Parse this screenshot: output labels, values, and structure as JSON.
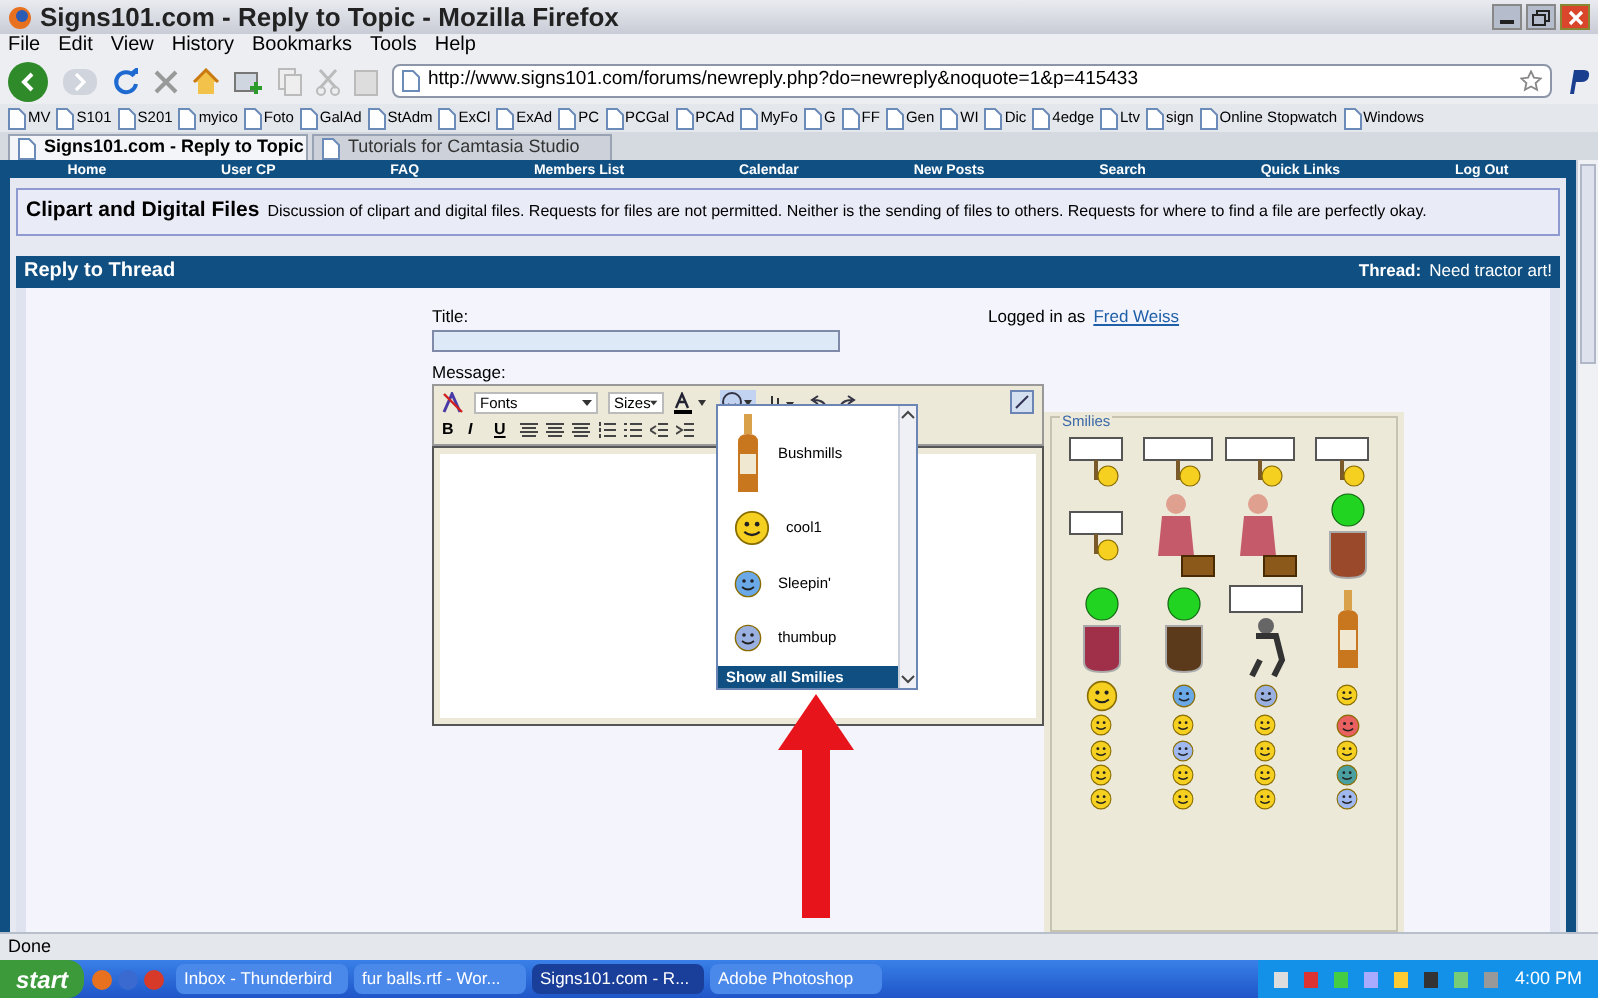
{
  "window": {
    "title": "Signs101.com - Reply to Topic - Mozilla Firefox"
  },
  "menu": [
    "File",
    "Edit",
    "View",
    "History",
    "Bookmarks",
    "Tools",
    "Help"
  ],
  "address": {
    "value": "http://www.signs101.com/forums/newreply.php?do=newreply&noquote=1&p=415433"
  },
  "bookmarks": [
    "MV",
    "S101",
    "S201",
    "myico",
    "Foto",
    "GalAd",
    "StAdm",
    "ExCl",
    "ExAd",
    "PC",
    "PCGal",
    "PCAd",
    "MyFo",
    "G",
    "FF",
    "Gen",
    "WI",
    "Dic",
    "4edge",
    "Ltv",
    "sign",
    "Online Stopwatch",
    "Windows"
  ],
  "tabs": [
    {
      "label": "Signs101.com - Reply to Topic",
      "selected": true
    },
    {
      "label": "Tutorials for Camtasia Studio",
      "selected": false
    }
  ],
  "site_nav": [
    "Home",
    "User CP",
    "FAQ",
    "Members List",
    "Calendar",
    "New Posts",
    "Search",
    "Quick Links",
    "Log Out"
  ],
  "forum": {
    "title": "Clipart and Digital Files",
    "description": "Discussion of clipart and digital files. Requests for files are not permitted. Neither is the sending of files to others. Requests for where to find a file are perfectly okay."
  },
  "reply": {
    "heading": "Reply to Thread",
    "thread_label": "Thread:",
    "thread_title": "Need tractor art!"
  },
  "form": {
    "title_label": "Title:",
    "logged_in": "Logged in as",
    "user": "Fred Weiss",
    "message_label": "Message:"
  },
  "editor": {
    "font_select": "Fonts",
    "size_select": "Sizes",
    "format_buttons": [
      "B",
      "I",
      "U"
    ]
  },
  "smilie_menu": {
    "items": [
      {
        "label": "Bushmills",
        "kind": "bottle"
      },
      {
        "label": "cool1",
        "kind": "cool"
      },
      {
        "label": "Sleepin'",
        "kind": "sleep"
      },
      {
        "label": "thumbup",
        "kind": "thumb"
      }
    ],
    "show_all": "Show all Smilies"
  },
  "smilies_panel": {
    "legend": "Smilies"
  },
  "status_bar": "Done",
  "taskbar": {
    "start": "start",
    "items": [
      {
        "label": "Inbox - Thunderbird",
        "selected": false
      },
      {
        "label": "fur balls.rtf - Wor...",
        "selected": false
      },
      {
        "label": "Signs101.com - R...",
        "selected": true
      },
      {
        "label": "Adobe Photoshop",
        "selected": false
      }
    ],
    "clock": "4:00 PM"
  }
}
